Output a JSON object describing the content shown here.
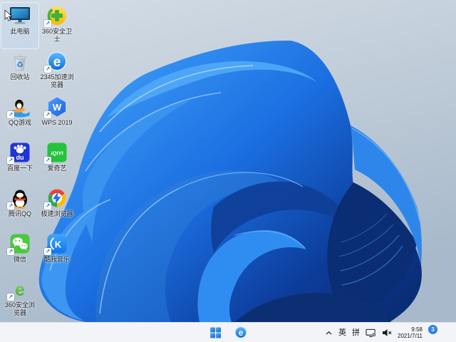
{
  "desktop": {
    "icons": [
      {
        "name": "this-pc",
        "label": "此电脑"
      },
      {
        "name": "recycle-bin",
        "label": "回收站"
      },
      {
        "name": "qq-games",
        "label": "QQ游戏"
      },
      {
        "name": "baidu-search",
        "label": "百度一下"
      },
      {
        "name": "tencent-qq",
        "label": "腾讯QQ"
      },
      {
        "name": "wechat",
        "label": "微信"
      },
      {
        "name": "360-safe-browser",
        "label": "360安全浏览器"
      },
      {
        "name": "360-safe-guard",
        "label": "360安全卫士"
      },
      {
        "name": "2345-browser",
        "label": "2345加速浏览器"
      },
      {
        "name": "wps-2019",
        "label": "WPS 2019"
      },
      {
        "name": "iqiyi",
        "label": "爱奇艺"
      },
      {
        "name": "speed-browser",
        "label": "极速浏览器"
      },
      {
        "name": "kuwo-music",
        "label": "酷我音乐"
      }
    ],
    "glyphs": {
      "e2345": "e",
      "e360": "e",
      "etaskbar": "e",
      "wps": "W",
      "baidu": "du",
      "iqiyi": "iQIYI",
      "kuwo": "K",
      "recycle": "♻"
    }
  },
  "taskbar": {
    "tray": {
      "ime_english": "英",
      "ime_pinyin": "拼"
    },
    "clock": {
      "time": "9:58",
      "date": "2021/7/11"
    },
    "notification_count": "3"
  },
  "colors": {
    "bloom_blue": "#1b6ee0",
    "background_top": "#d3dce5",
    "background_bottom": "#a7b9cc",
    "taskbar_bg": "#f2f4f7",
    "badge_blue": "#2f7fe8"
  }
}
